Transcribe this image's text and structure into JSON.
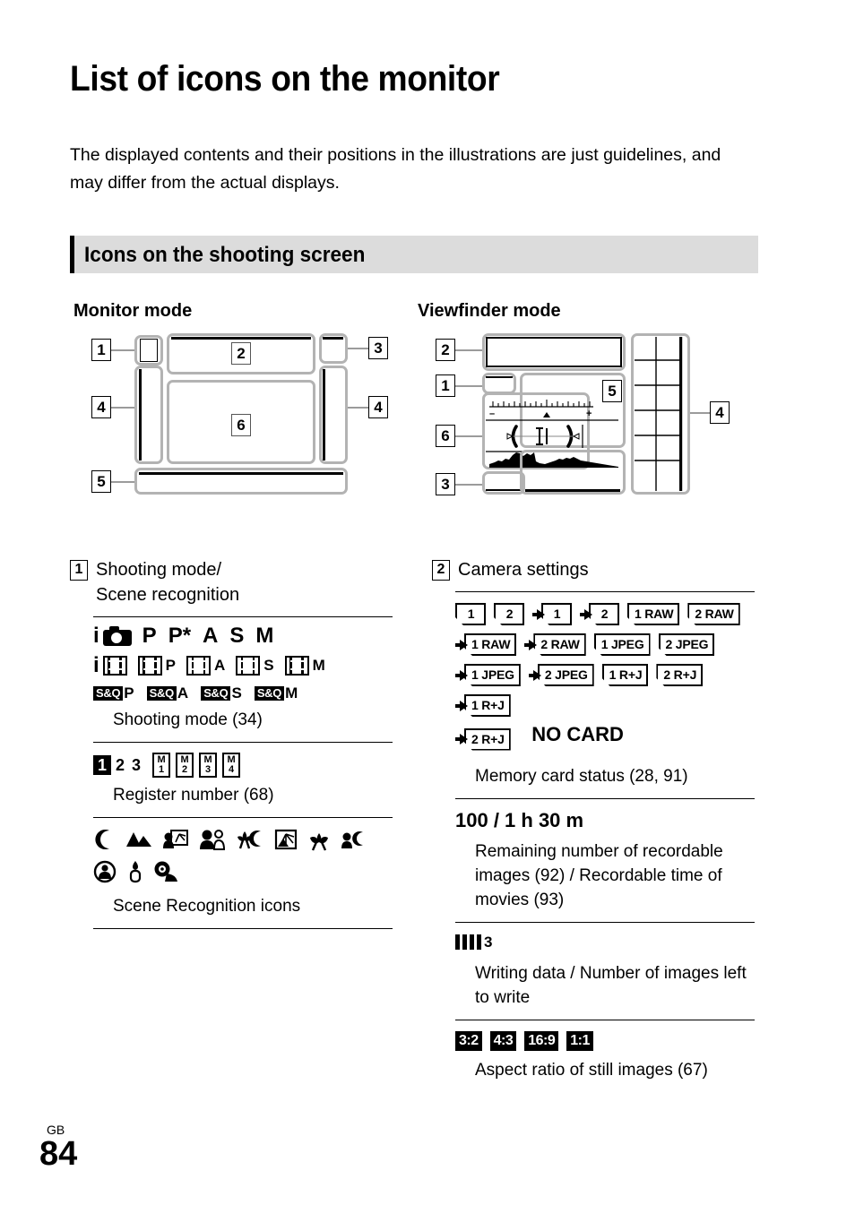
{
  "page": {
    "title": "List of icons on the monitor",
    "intro": "The displayed contents and their positions in the illustrations are just guidelines, and may differ from the actual displays.",
    "section_header": "Icons on the shooting screen",
    "footer_locale": "GB",
    "footer_page": "84"
  },
  "diagrams": {
    "monitor": {
      "heading": "Monitor mode",
      "callouts": [
        "1",
        "2",
        "3",
        "4",
        "4",
        "5",
        "6"
      ]
    },
    "viewfinder": {
      "heading": "Viewfinder mode",
      "callouts": [
        "1",
        "2",
        "3",
        "4",
        "5",
        "6"
      ]
    }
  },
  "left_column": {
    "number": "1",
    "title_line1": "Shooting mode/",
    "title_line2": "Scene recognition",
    "entries": [
      {
        "icons_row1": [
          "i",
          "camera-icon",
          "P",
          "P*",
          "A",
          "S",
          "M"
        ],
        "icons_row2": [
          "i",
          "movie-icon",
          "movie-P",
          "movie-A",
          "movie-S",
          "movie-M"
        ],
        "icons_row3": [
          "S&Q P",
          "S&Q A",
          "S&Q S",
          "S&Q M"
        ],
        "caption": "Shooting mode (34)"
      },
      {
        "icons": [
          "1",
          "2",
          "3",
          "M1",
          "M2",
          "M3",
          "M4"
        ],
        "caption": "Register number (68)"
      },
      {
        "icons_row1": [
          "night-scene-icon",
          "landscape-icon",
          "backlight-portrait-icon",
          "portrait-icon",
          "night-macro-icon",
          "backlight-icon",
          "macro-icon",
          "night-portrait-icon"
        ],
        "icons_row2": [
          "spotlight-portrait-icon",
          "low-light-icon",
          "tripod-icon"
        ],
        "caption": "Scene Recognition icons"
      }
    ]
  },
  "right_column": {
    "number": "2",
    "title": "Camera settings",
    "entries": [
      {
        "cards": [
          {
            "arrow": false,
            "label": "1"
          },
          {
            "arrow": false,
            "label": "2"
          },
          {
            "arrow": true,
            "label": "1"
          },
          {
            "arrow": true,
            "label": "2"
          },
          {
            "arrow": false,
            "label": "1 RAW"
          },
          {
            "arrow": false,
            "label": "2 RAW"
          },
          {
            "arrow": true,
            "label": "1 RAW"
          },
          {
            "arrow": true,
            "label": "2 RAW"
          },
          {
            "arrow": false,
            "label": "1 JPEG"
          },
          {
            "arrow": false,
            "label": "2 JPEG"
          },
          {
            "arrow": true,
            "label": "1 JPEG"
          },
          {
            "arrow": true,
            "label": "2 JPEG"
          },
          {
            "arrow": false,
            "label": "1 R+J"
          },
          {
            "arrow": false,
            "label": "2 R+J"
          },
          {
            "arrow": true,
            "label": "1 R+J"
          },
          {
            "arrow": true,
            "label": "2 R+J"
          }
        ],
        "no_card": "NO CARD",
        "caption": "Memory card status (28, 91)"
      },
      {
        "sample": "100 / 1 h 30 m",
        "caption": "Remaining number of recordable images (92) / Recordable time of movies (93)"
      },
      {
        "writing_bars": 4,
        "writing_number": "3",
        "caption": "Writing data / Number of images left to write"
      },
      {
        "aspects": [
          "3:2",
          "4:3",
          "16:9",
          "1:1"
        ],
        "caption": "Aspect ratio of still images (67)"
      }
    ]
  }
}
